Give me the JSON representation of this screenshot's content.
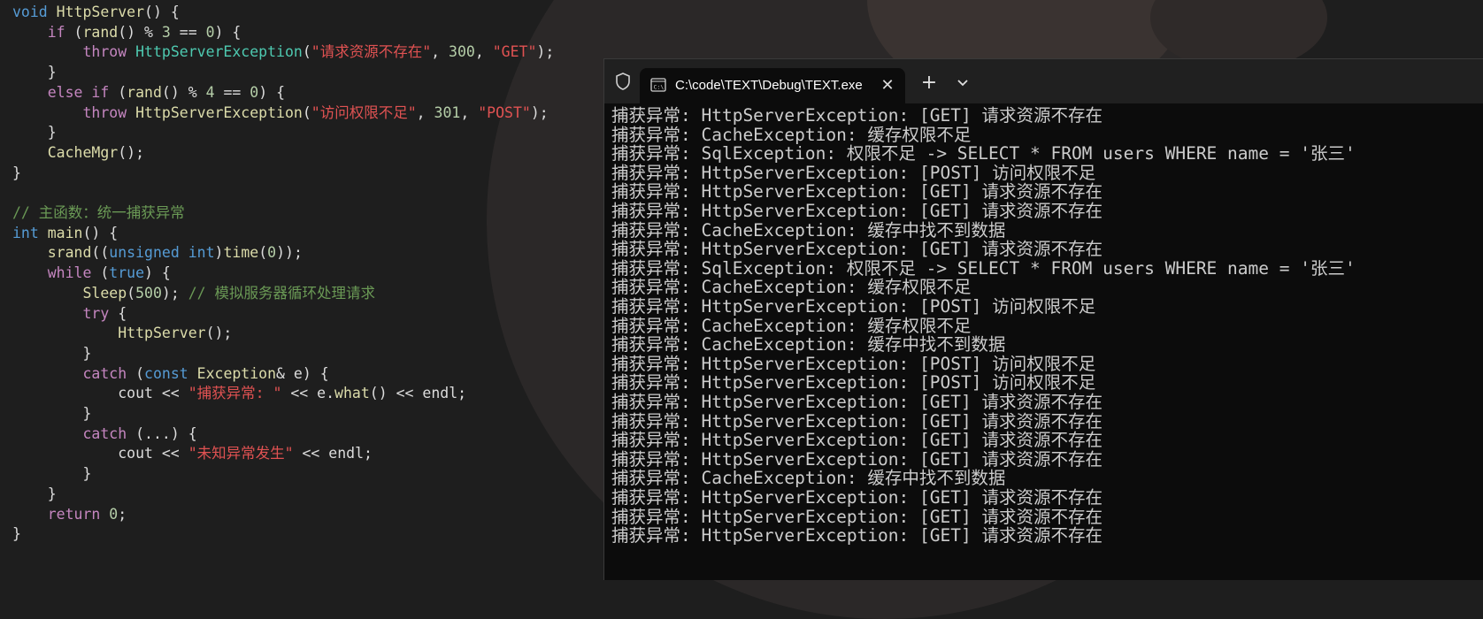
{
  "editor": {
    "lines": [
      [
        [
          "kwb",
          "void "
        ],
        [
          "fn",
          "HttpServer"
        ],
        [
          "plain",
          "() {"
        ]
      ],
      [
        [
          "plain",
          "    "
        ],
        [
          "kw",
          "if"
        ],
        [
          "plain",
          " ("
        ],
        [
          "fn",
          "rand"
        ],
        [
          "plain",
          "() % "
        ],
        [
          "num",
          "3"
        ],
        [
          "plain",
          " == "
        ],
        [
          "num",
          "0"
        ],
        [
          "plain",
          ") {"
        ]
      ],
      [
        [
          "plain",
          "        "
        ],
        [
          "kw",
          "throw"
        ],
        [
          "plain",
          " "
        ],
        [
          "cls",
          "HttpServerException"
        ],
        [
          "plain",
          "("
        ],
        [
          "strc",
          "\"请求资源不存在\""
        ],
        [
          "plain",
          ", "
        ],
        [
          "num",
          "300"
        ],
        [
          "plain",
          ", "
        ],
        [
          "strc",
          "\"GET\""
        ],
        [
          "plain",
          ");"
        ]
      ],
      [
        [
          "plain",
          "    }"
        ]
      ],
      [
        [
          "plain",
          "    "
        ],
        [
          "kw",
          "else if"
        ],
        [
          "plain",
          " ("
        ],
        [
          "fn",
          "rand"
        ],
        [
          "plain",
          "() % "
        ],
        [
          "num",
          "4"
        ],
        [
          "plain",
          " == "
        ],
        [
          "num",
          "0"
        ],
        [
          "plain",
          ") {"
        ]
      ],
      [
        [
          "plain",
          "        "
        ],
        [
          "kw",
          "throw"
        ],
        [
          "plain",
          " "
        ],
        [
          "typ",
          "HttpServerException"
        ],
        [
          "plain",
          "("
        ],
        [
          "strc",
          "\"访问权限不足\""
        ],
        [
          "plain",
          ", "
        ],
        [
          "num",
          "301"
        ],
        [
          "plain",
          ", "
        ],
        [
          "strc",
          "\"POST\""
        ],
        [
          "plain",
          ");"
        ]
      ],
      [
        [
          "plain",
          "    }"
        ]
      ],
      [
        [
          "plain",
          "    "
        ],
        [
          "fn",
          "CacheMgr"
        ],
        [
          "plain",
          "();"
        ]
      ],
      [
        [
          "plain",
          "}"
        ]
      ],
      [
        [
          "plain",
          ""
        ]
      ],
      [
        [
          "cmt",
          "// 主函数：统一捕获异常"
        ]
      ],
      [
        [
          "kwb",
          "int "
        ],
        [
          "fn",
          "main"
        ],
        [
          "plain",
          "() {"
        ]
      ],
      [
        [
          "plain",
          "    "
        ],
        [
          "fn",
          "srand"
        ],
        [
          "plain",
          "(("
        ],
        [
          "kwb",
          "unsigned int"
        ],
        [
          "plain",
          ")"
        ],
        [
          "fn",
          "time"
        ],
        [
          "plain",
          "("
        ],
        [
          "num",
          "0"
        ],
        [
          "plain",
          "));"
        ]
      ],
      [
        [
          "plain",
          "    "
        ],
        [
          "kw",
          "while"
        ],
        [
          "plain",
          " ("
        ],
        [
          "kwb",
          "true"
        ],
        [
          "plain",
          ") {"
        ]
      ],
      [
        [
          "plain",
          "        "
        ],
        [
          "fn",
          "Sleep"
        ],
        [
          "plain",
          "("
        ],
        [
          "num",
          "500"
        ],
        [
          "plain",
          "); "
        ],
        [
          "cmt",
          "// 模拟服务器循环处理请求"
        ]
      ],
      [
        [
          "plain",
          "        "
        ],
        [
          "kw",
          "try"
        ],
        [
          "plain",
          " {"
        ]
      ],
      [
        [
          "plain",
          "            "
        ],
        [
          "fn",
          "HttpServer"
        ],
        [
          "plain",
          "();"
        ]
      ],
      [
        [
          "plain",
          "        }"
        ]
      ],
      [
        [
          "plain",
          "        "
        ],
        [
          "kw",
          "catch"
        ],
        [
          "plain",
          " ("
        ],
        [
          "kwb",
          "const "
        ],
        [
          "typ",
          "Exception"
        ],
        [
          "plain",
          "& e) {"
        ]
      ],
      [
        [
          "plain",
          "            cout << "
        ],
        [
          "strc",
          "\"捕获异常: \""
        ],
        [
          "plain",
          " << e."
        ],
        [
          "fn",
          "what"
        ],
        [
          "plain",
          "() << endl;"
        ]
      ],
      [
        [
          "plain",
          "        }"
        ]
      ],
      [
        [
          "plain",
          "        "
        ],
        [
          "kw",
          "catch"
        ],
        [
          "plain",
          " (...) {"
        ]
      ],
      [
        [
          "plain",
          "            cout << "
        ],
        [
          "strc",
          "\"未知异常发生\""
        ],
        [
          "plain",
          " << endl;"
        ]
      ],
      [
        [
          "plain",
          "        }"
        ]
      ],
      [
        [
          "plain",
          "    }"
        ]
      ],
      [
        [
          "plain",
          "    "
        ],
        [
          "kw",
          "return"
        ],
        [
          "plain",
          " "
        ],
        [
          "num",
          "0"
        ],
        [
          "plain",
          ";"
        ]
      ],
      [
        [
          "plain",
          "}"
        ]
      ]
    ]
  },
  "terminal": {
    "tab_title": "C:\\code\\TEXT\\Debug\\TEXT.exe",
    "close_label": "✕",
    "new_tab_label": "+",
    "output": [
      "捕获异常: HttpServerException: [GET] 请求资源不存在",
      "捕获异常: CacheException: 缓存权限不足",
      "捕获异常: SqlException: 权限不足 -> SELECT * FROM users WHERE name = '张三'",
      "捕获异常: HttpServerException: [POST] 访问权限不足",
      "捕获异常: HttpServerException: [GET] 请求资源不存在",
      "捕获异常: HttpServerException: [GET] 请求资源不存在",
      "捕获异常: CacheException: 缓存中找不到数据",
      "捕获异常: HttpServerException: [GET] 请求资源不存在",
      "捕获异常: SqlException: 权限不足 -> SELECT * FROM users WHERE name = '张三'",
      "捕获异常: CacheException: 缓存权限不足",
      "捕获异常: HttpServerException: [POST] 访问权限不足",
      "捕获异常: CacheException: 缓存权限不足",
      "捕获异常: CacheException: 缓存中找不到数据",
      "捕获异常: HttpServerException: [POST] 访问权限不足",
      "捕获异常: HttpServerException: [POST] 访问权限不足",
      "捕获异常: HttpServerException: [GET] 请求资源不存在",
      "捕获异常: HttpServerException: [GET] 请求资源不存在",
      "捕获异常: HttpServerException: [GET] 请求资源不存在",
      "捕获异常: HttpServerException: [GET] 请求资源不存在",
      "捕获异常: CacheException: 缓存中找不到数据",
      "捕获异常: HttpServerException: [GET] 请求资源不存在",
      "捕获异常: HttpServerException: [GET] 请求资源不存在",
      "捕获异常: HttpServerException: [GET] 请求资源不存在"
    ]
  },
  "colors": {
    "editor_bg": "#1e1e1e",
    "terminal_bg": "#0c0c0c",
    "titlebar_bg": "#202020"
  },
  "icons": {
    "shield": "shield-icon",
    "terminal": "terminal-app-icon",
    "close": "close-icon",
    "new_tab": "plus-icon",
    "dropdown": "chevron-down-icon"
  }
}
